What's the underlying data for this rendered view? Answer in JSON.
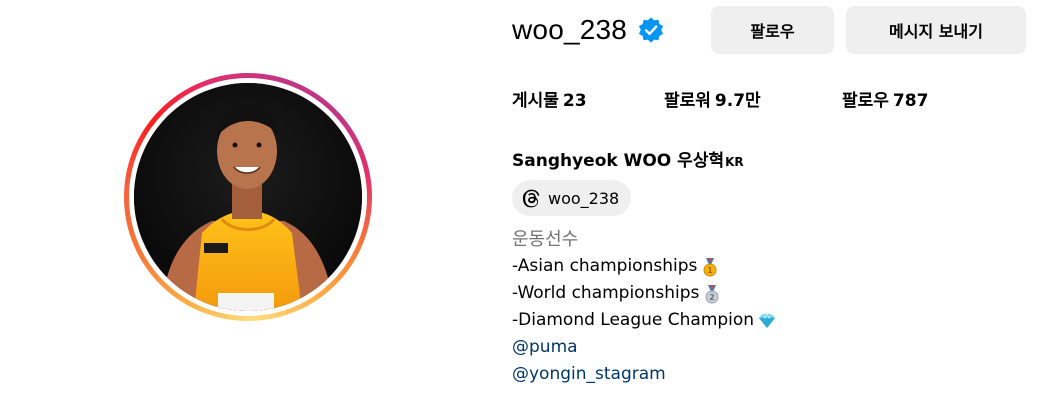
{
  "profile": {
    "username": "woo_238",
    "full_name": "Sanghyeok WOO 우상혁",
    "full_name_suffix": "KR",
    "verified": true
  },
  "buttons": {
    "follow": "팔로우",
    "message": "메시지 보내기"
  },
  "stats": {
    "posts_label": "게시물",
    "posts_count": "23",
    "followers_label": "팔로워",
    "followers_count": "9.7만",
    "following_label": "팔로우",
    "following_count": "787"
  },
  "threads": {
    "handle": "woo_238",
    "icon": "threads-icon"
  },
  "bio": {
    "category": "운동선수",
    "lines": [
      {
        "text": "-Asian championships",
        "emoji": "gold-medal-icon"
      },
      {
        "text": "-World championships",
        "emoji": "silver-medal-icon"
      },
      {
        "text": "-Diamond League Champion",
        "emoji": "diamond-icon"
      }
    ],
    "links": [
      "@puma",
      "@yongin_stagram"
    ]
  },
  "colors": {
    "verified_blue": "#0095f6",
    "button_bg": "#efefef",
    "link": "#00376b",
    "category_gray": "#737373"
  }
}
